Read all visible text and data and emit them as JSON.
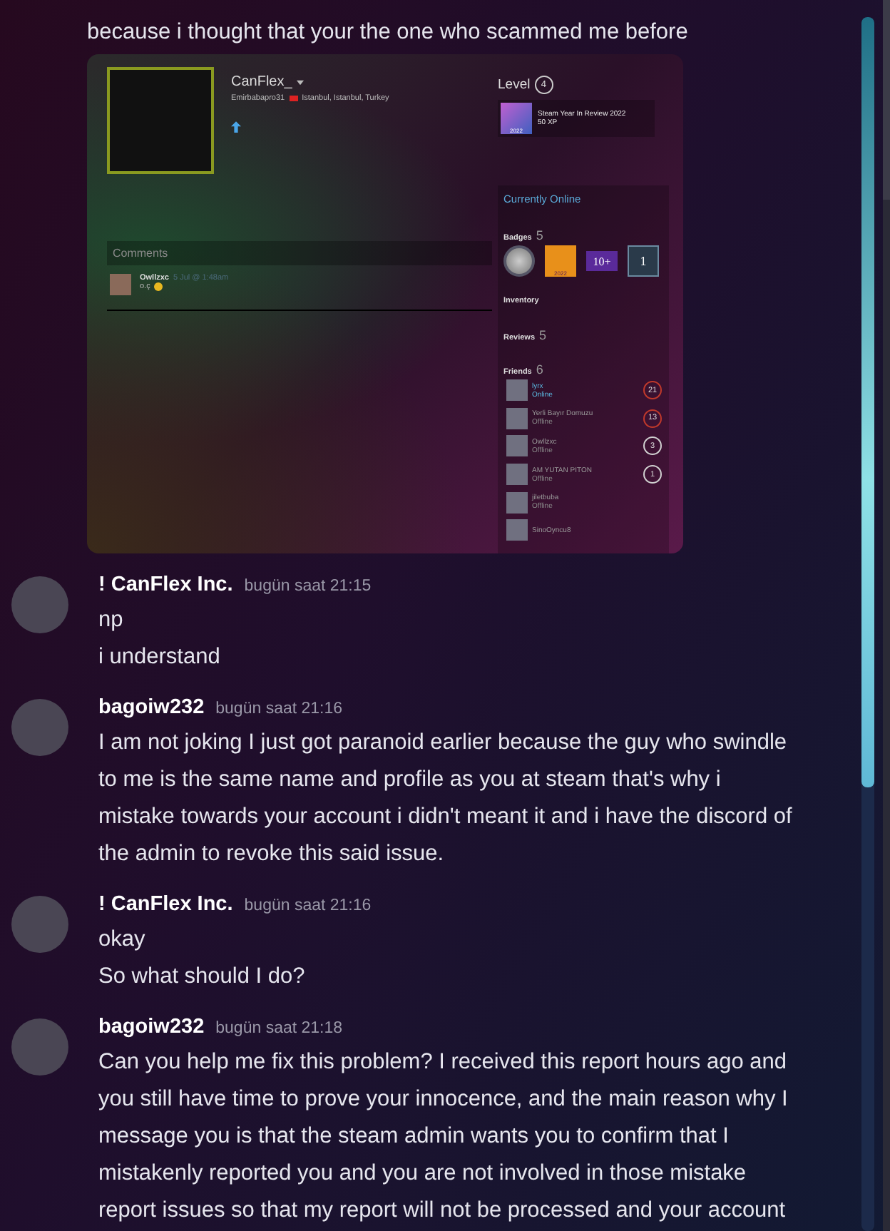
{
  "messages": [
    {
      "kind": "continuation",
      "lines": [
        "because i thought that your the one who scammed me before"
      ],
      "attachment": {
        "profile": {
          "name": "CanFlex_",
          "alias": "Emirbabapro31",
          "location": "Istanbul, Istanbul, Turkey",
          "level_label": "Level",
          "level": "4",
          "xp_badge": {
            "title": "Steam Year In Review 2022",
            "xp": "50 XP",
            "icon_label": "2022"
          },
          "status": "Currently Online",
          "comments": {
            "title": "Comments",
            "items": [
              {
                "author": "Owllzxc",
                "time": "5 Jul @ 1:48am",
                "text": "o.ç"
              }
            ]
          },
          "badges": {
            "label": "Badges",
            "count": "5",
            "items": [
              {
                "kind": "coin"
              },
              {
                "kind": "year",
                "label": "2022"
              },
              {
                "kind": "tag",
                "label": "10+"
              },
              {
                "kind": "tile",
                "label": "1"
              }
            ]
          },
          "inventory": "Inventory",
          "reviews": {
            "label": "Reviews",
            "count": "5"
          },
          "friends": {
            "label": "Friends",
            "count": "6",
            "items": [
              {
                "name": "lyrx",
                "status": "Online",
                "online": true,
                "level": "21",
                "color": "#c0392b"
              },
              {
                "name": "Yerli Bayır Domuzu",
                "status": "Offline",
                "online": false,
                "level": "13",
                "color": "#c0392b"
              },
              {
                "name": "Owllzxc",
                "status": "Offline",
                "online": false,
                "level": "3",
                "color": "#d0d0d0"
              },
              {
                "name": "AM YUTAN PITON",
                "status": "Offline",
                "online": false,
                "level": "1",
                "color": "#d0d0d0"
              },
              {
                "name": "jiletbuba",
                "status": "Offline",
                "online": false
              },
              {
                "name": "SinoOyncu8",
                "online": false
              }
            ]
          }
        }
      }
    },
    {
      "kind": "message",
      "author": "! CanFlex Inc.",
      "time": "bugün saat 21:15",
      "lines": [
        "np",
        "i understand"
      ]
    },
    {
      "kind": "message",
      "author": "bagoiw232",
      "time": "bugün saat 21:16",
      "lines": [
        "I am not joking I just got paranoid earlier because the guy who swindle to me is the same name and profile as you at steam that's why i mistake towards your account i didn't meant it and i have the discord of the admin to revoke this said issue."
      ]
    },
    {
      "kind": "message",
      "author": "! CanFlex Inc.",
      "time": "bugün saat 21:16",
      "lines": [
        "okay",
        "So what should I do?"
      ]
    },
    {
      "kind": "message",
      "author": "bagoiw232",
      "time": "bugün saat 21:18",
      "lines": [
        "Can you help me fix this problem? I received this report hours ago and you still have time to prove your innocence, and the main reason why I message you is that the steam admin wants you to confirm that I mistakenly reported you and you are not involved in those mistake report issues so that my report will not be processed and your account"
      ]
    }
  ]
}
